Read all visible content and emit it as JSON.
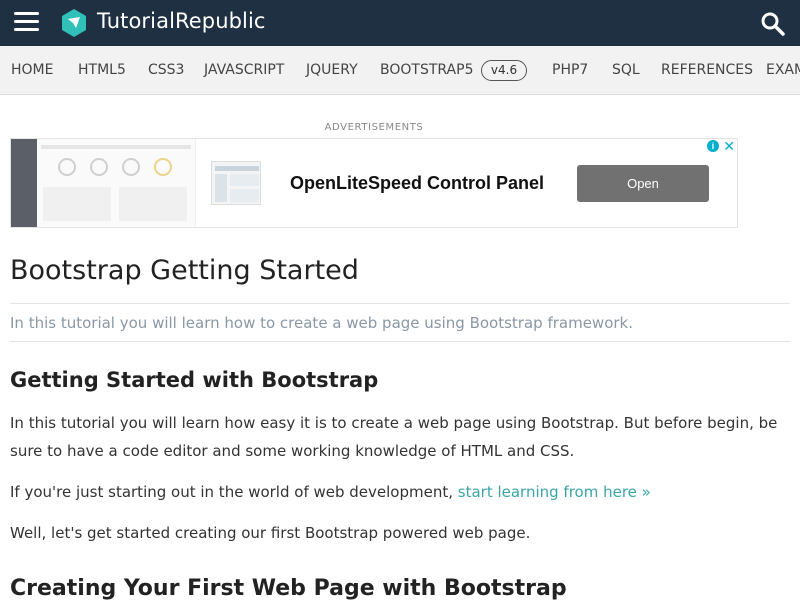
{
  "header": {
    "brand": "TutorialRepublic",
    "brand_color": "#1f3043",
    "logo_color": "#2fc1b8",
    "menu_icon": "hamburger-menu-icon",
    "search_icon": "search-icon"
  },
  "nav": {
    "items": [
      "HOME",
      "HTML5",
      "CSS3",
      "JAVASCRIPT",
      "JQUERY",
      "BOOTSTRAP5",
      "PHP7",
      "SQL",
      "REFERENCES",
      "EXAM"
    ],
    "badge": "v4.6"
  },
  "ad": {
    "label": "ADVERTISEMENTS",
    "title": "OpenLiteSpeed Control Panel",
    "button": "Open",
    "info_icon": "info-icon",
    "close_icon": "close-icon",
    "info_glyph": "i",
    "close_glyph": "✕"
  },
  "content": {
    "title": "Bootstrap Getting Started",
    "lead": "In this tutorial you will learn how to create a web page using Bootstrap framework.",
    "section1_title": "Getting Started with Bootstrap",
    "para1": "In this tutorial you will learn how easy it is to create a web page using Bootstrap. But before begin, be sure to have a code editor and some working knowledge of HTML and CSS.",
    "para2_text": "If you're just starting out in the world of web development, ",
    "para2_link": "start learning from here »",
    "para3": "Well, let's get started creating our first Bootstrap powered web page.",
    "section2_title": "Creating Your First Web Page with Bootstrap",
    "link_color": "#3aa5a5"
  }
}
